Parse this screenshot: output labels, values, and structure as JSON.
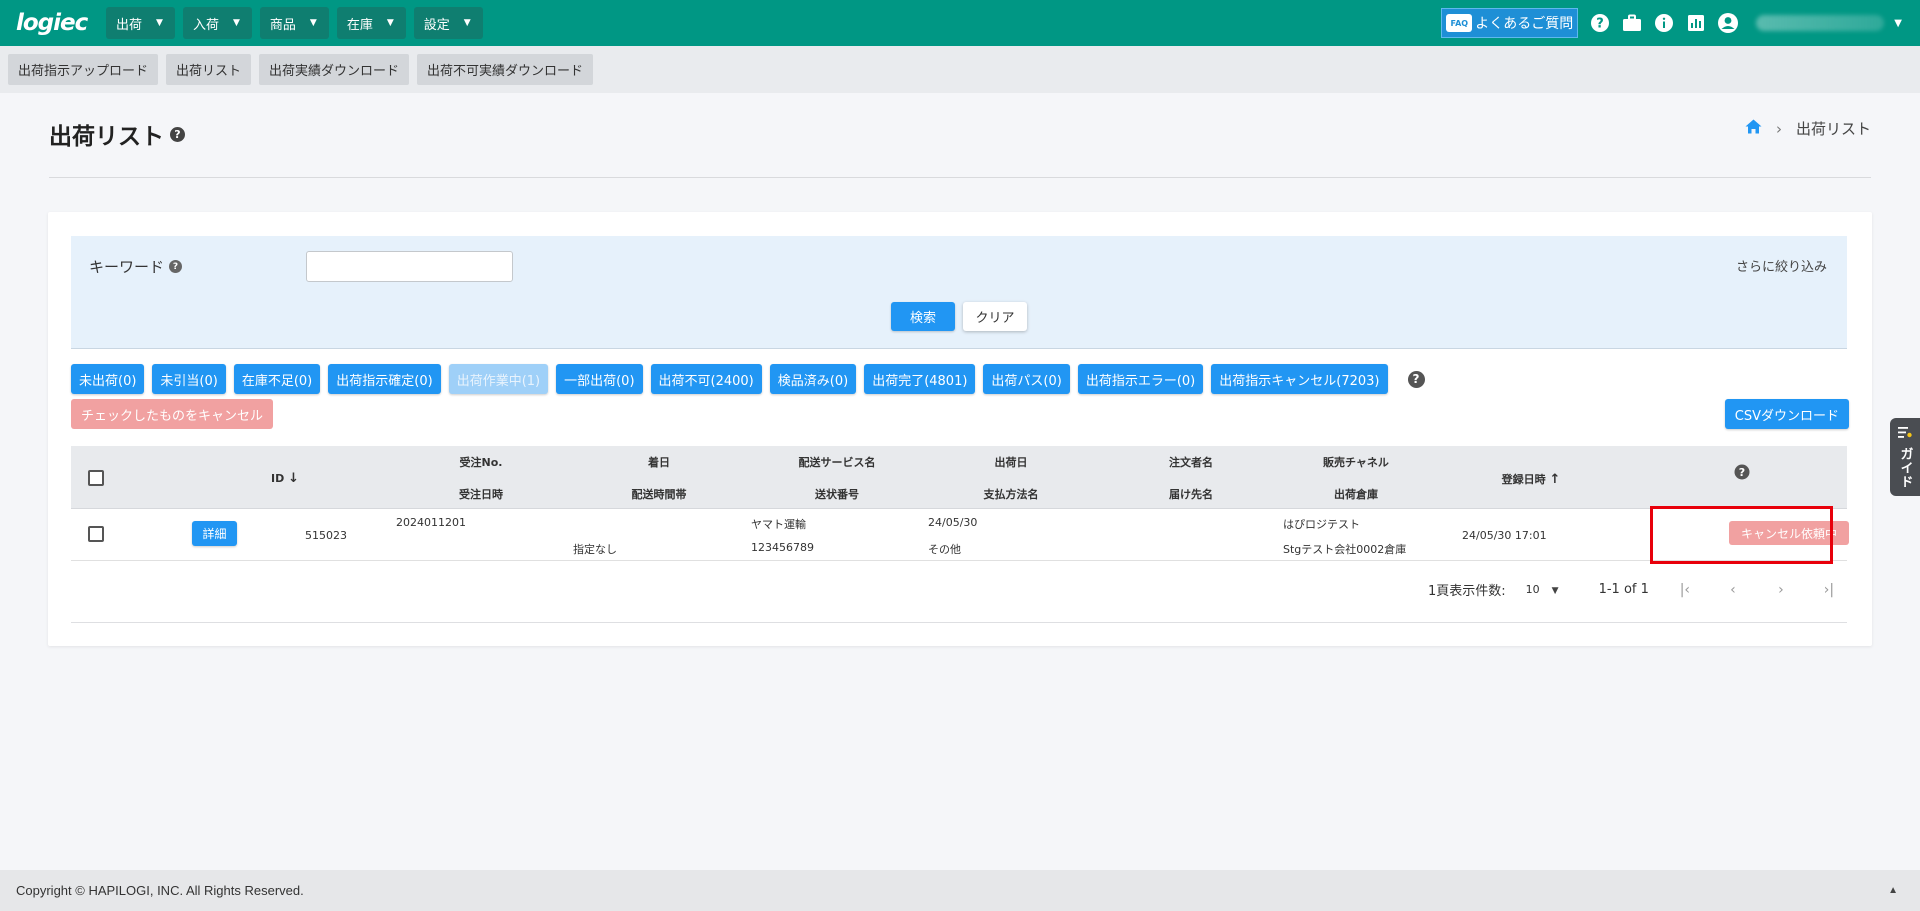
{
  "header": {
    "logo": "logiec",
    "menus": [
      {
        "label": "出荷"
      },
      {
        "label": "入荷"
      },
      {
        "label": "商品"
      },
      {
        "label": "在庫"
      },
      {
        "label": "設定"
      }
    ],
    "faq_badge": "FAQ",
    "faq_label": "よくあるご質問",
    "icons": [
      "help-icon",
      "briefcase-icon",
      "info-icon",
      "chart-icon",
      "account-icon"
    ],
    "accent_color": "#009784"
  },
  "subnav": {
    "buttons": [
      {
        "label": "出荷指示アップロード"
      },
      {
        "label": "出荷リスト"
      },
      {
        "label": "出荷実績ダウンロード"
      },
      {
        "label": "出荷不可実績ダウンロード"
      }
    ]
  },
  "page": {
    "title": "出荷リスト",
    "breadcrumb": [
      "出荷リスト"
    ]
  },
  "search": {
    "keyword_label": "キーワード",
    "keyword_value": "",
    "narrow_label": "さらに絞り込み",
    "search_label": "検索",
    "clear_label": "クリア"
  },
  "filters": [
    {
      "label": "未出荷(0)",
      "disabled": false
    },
    {
      "label": "未引当(0)",
      "disabled": false
    },
    {
      "label": "在庫不足(0)",
      "disabled": false
    },
    {
      "label": "出荷指示確定(0)",
      "disabled": false
    },
    {
      "label": "出荷作業中(1)",
      "disabled": true
    },
    {
      "label": "一部出荷(0)",
      "disabled": false
    },
    {
      "label": "出荷不可(2400)",
      "disabled": false
    },
    {
      "label": "検品済み(0)",
      "disabled": false
    },
    {
      "label": "出荷完了(4801)",
      "disabled": false
    },
    {
      "label": "出荷パス(0)",
      "disabled": false
    },
    {
      "label": "出荷指示エラー(0)",
      "disabled": false
    },
    {
      "label": "出荷指示キャンセル(7203)",
      "disabled": false
    }
  ],
  "actions": {
    "cancel_checked": "チェックしたものをキャンセル",
    "csv_download": "CSVダウンロード"
  },
  "table": {
    "headers": {
      "id": "ID",
      "order_no": "受注No.",
      "order_date": "受注日時",
      "arrival_date": "着日",
      "time_slot": "配送時間帯",
      "delivery_service": "配送サービス名",
      "tracking_no": "送状番号",
      "ship_date": "出荷日",
      "payment": "支払方法名",
      "orderer": "注文者名",
      "recipient": "届け先名",
      "channel": "販売チャネル",
      "warehouse": "出荷倉庫",
      "registered": "登録日時"
    },
    "rows": [
      {
        "detail_label": "詳細",
        "id": "515023",
        "order_no": "2024011201",
        "order_date": "",
        "arrival_date": "",
        "time_slot": "指定なし",
        "delivery_service": "ヤマト運輸",
        "tracking_no": "123456789",
        "ship_date": "24/05/30",
        "payment": "その他",
        "orderer": "",
        "recipient": "",
        "channel": "はぴロジテスト",
        "warehouse": "Stgテスト会社0002倉庫",
        "registered": "24/05/30 17:01",
        "status_button": "キャンセル依頼中"
      }
    ]
  },
  "pagination": {
    "per_page_label": "1頁表示件数:",
    "per_page_value": "10",
    "range": "1-1 of 1"
  },
  "guide_label": "ガイド",
  "footer": {
    "copyright": "Copyright © HAPILOGI, INC. All Rights Reserved."
  }
}
